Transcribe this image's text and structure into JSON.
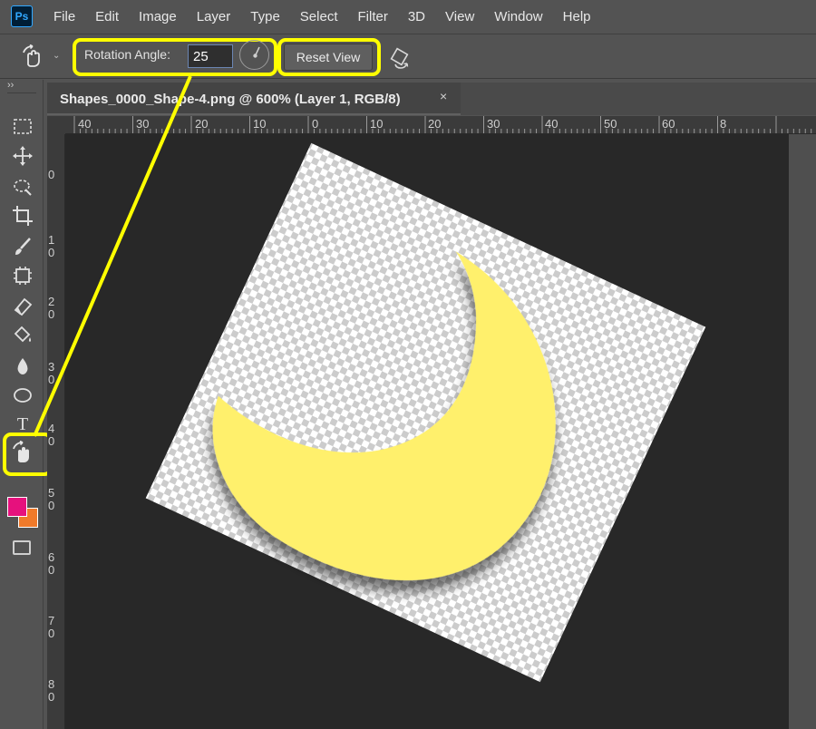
{
  "app": {
    "logo": "Ps"
  },
  "menu": [
    "File",
    "Edit",
    "Image",
    "Layer",
    "Type",
    "Select",
    "Filter",
    "3D",
    "View",
    "Window",
    "Help"
  ],
  "options_bar": {
    "tool_icon": "rotate-view-icon",
    "rotation_label": "Rotation Angle:",
    "rotation_value": "25",
    "reset_label": "Reset View",
    "rotate_all_windows_icon": "rotate-all-windows-icon"
  },
  "document": {
    "tab_title": "Shapes_0000_Shape-4.png @ 600% (Layer 1, RGB/8)",
    "close_glyph": "×",
    "rotation_degrees": 25
  },
  "ruler_h": [
    "40",
    "30",
    "20",
    "10",
    "0",
    "10",
    "20",
    "30",
    "40",
    "50",
    "60",
    "8"
  ],
  "ruler_v": [
    "0",
    "10",
    "20",
    "30",
    "40",
    "50",
    "60",
    "70",
    "80"
  ],
  "toolbar": {
    "tools": [
      "marquee-icon",
      "move-icon",
      "lasso-icon",
      "crop-icon",
      "brush-icon",
      "stamp-icon",
      "eraser-icon",
      "paint-bucket-icon",
      "blur-drop-icon",
      "ellipse-icon",
      "type-icon",
      "rotate-view-icon"
    ],
    "type_glyph": "T"
  },
  "colors": {
    "foreground": "#e6117d",
    "background": "#f07a2a",
    "highlight": "#ffff00",
    "shape_fill": "#fff06c"
  }
}
